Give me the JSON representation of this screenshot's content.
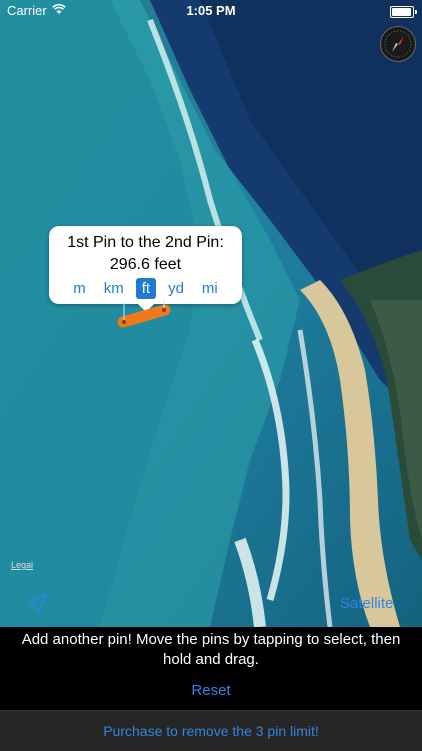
{
  "status_bar": {
    "carrier": "Carrier",
    "time": "1:05 PM"
  },
  "map": {
    "legal_label": "Legal",
    "map_type_label": "Satellite",
    "callout": {
      "title": "1st Pin to the 2nd Pin:",
      "distance": "296.6 feet",
      "units": [
        "m",
        "km",
        "ft",
        "yd",
        "mi"
      ],
      "selected_unit": "ft"
    },
    "icons": [
      "wifi-icon",
      "battery-icon",
      "compass-icon",
      "location-arrow-icon",
      "pin-icon"
    ]
  },
  "bottom_panel": {
    "message": "Add another pin! Move the pins by tapping to select, then hold and drag.",
    "reset_label": "Reset"
  },
  "purchase_label": "Purchase to remove the 3 pin limit!",
  "colors": {
    "accent": "#1f7ad6",
    "pin": "#f07a1a",
    "panel": "#000000"
  }
}
